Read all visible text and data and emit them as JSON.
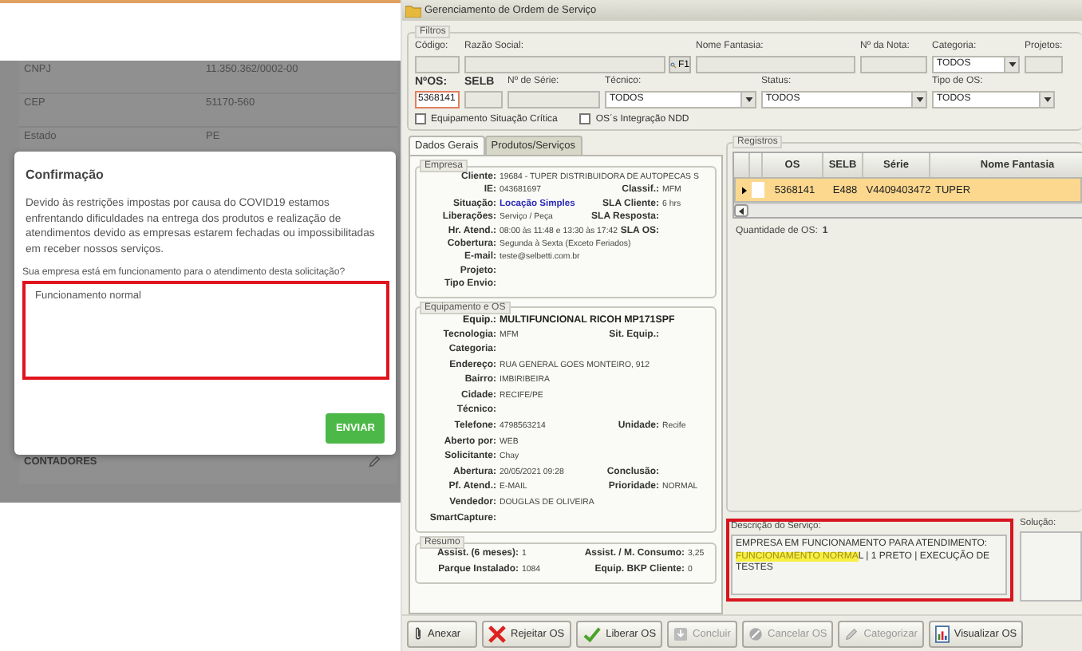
{
  "web_page": {
    "background_rows": [
      {
        "label": "CNPJ",
        "value": "11.350.362/0002-00"
      },
      {
        "label": "CEP",
        "value": "51170-560"
      },
      {
        "label": "Estado",
        "value": "PE"
      }
    ],
    "section": {
      "title": "CONTADORES"
    },
    "dialog": {
      "title": "Confirmação",
      "message": "Devido às restrições impostas por causa do COVID19 estamos enfrentando dificuldades na entrega dos produtos e realização de atendimentos devido as empresas estarem fechadas ou impossibilitadas em receber nossos serviços.",
      "question": "Sua empresa está em funcionamento para o atendimento desta solicitação?",
      "answer": {
        "value": "Funcionamento normal",
        "marked": true
      },
      "button": "ENVIAR"
    }
  },
  "window": {
    "title": "Gerenciamento de Ordem de Serviço",
    "filters": {
      "title": "Filtros",
      "row_1": [
        {
          "label": "Código:",
          "kind": "text",
          "bold": false
        },
        {
          "label": "Razão Social:",
          "kind": "lookup",
          "button": "F1",
          "bold": false
        },
        {
          "label": "Nome Fantasia:",
          "kind": "text",
          "bold": false
        },
        {
          "label": "Nº da Nota:",
          "kind": "text",
          "bold": false
        },
        {
          "label": "Categoria:",
          "kind": "select",
          "value": "TODOS",
          "bold": false
        },
        {
          "label": "Projetos:",
          "kind": "text",
          "bold": false
        }
      ],
      "row_2": [
        {
          "label": "NºOS:",
          "kind": "input",
          "value": "5368141",
          "bold": true
        },
        {
          "label": "SELB",
          "kind": "text",
          "bold": true
        },
        {
          "label": "Nº de Série:",
          "kind": "text",
          "bold": false
        },
        {
          "label": "Técnico:",
          "kind": "select",
          "value": "TODOS",
          "bold": false
        },
        {
          "label": "Status:",
          "kind": "select",
          "value": "TODOS",
          "bold": false
        },
        {
          "label": "Tipo de OS:",
          "kind": "select",
          "value": "TODOS",
          "bold": false
        }
      ],
      "checkboxes": [
        {
          "label": "Equipamento Situação Crítica",
          "checked": false
        },
        {
          "label": "OS´s Integração NDD",
          "checked": false
        }
      ]
    },
    "tabs": [
      {
        "label": "Dados Gerais",
        "selected": true
      },
      {
        "label": "Produtos/Serviços",
        "selected": false
      }
    ],
    "empresa": {
      "title": "Empresa",
      "rows": [
        {
          "label": "Cliente:",
          "value": "19684 - TUPER DISTRIBUIDORA DE AUTOPECAS S",
          "kind": "plain"
        },
        {
          "label": "IE:",
          "value": "043681697",
          "label2": "Classif.:",
          "value2": "MFM",
          "kind": "plain"
        },
        {
          "label": "Situação:",
          "value": "Locação Simples",
          "label2": "SLA Cliente:",
          "value2": "6 hrs",
          "kind": "status"
        },
        {
          "label": "Liberações:",
          "value": "Serviço / Peça",
          "label2": "SLA Resposta:",
          "kind": "plain"
        },
        {
          "label": "Hr. Atend.:",
          "value": "08:00 às 11:48 e 13:30 às 17:42",
          "label2": "SLA OS:",
          "kind": "plain"
        },
        {
          "label": "Cobertura:",
          "value": "Segunda à Sexta (Exceto Feriados)",
          "kind": "plain"
        },
        {
          "label": "E-mail:",
          "value": "teste@selbetti.com.br",
          "kind": "plain"
        },
        {
          "label": "Projeto:"
        },
        {
          "label": "Tipo Envio:"
        }
      ]
    },
    "equipamento": {
      "title": "Equipamento e OS",
      "equip_label": "Equip.:",
      "equip_value": "MULTIFUNCIONAL RICOH MP171SPF",
      "rows": [
        {
          "label": "Tecnologia:",
          "value": "MFM",
          "label2": "Sit. Equip.:"
        },
        {
          "label": "Categoria:"
        },
        {
          "label": "Endereço:",
          "value": "RUA GENERAL GOES MONTEIRO, 912"
        },
        {
          "label": "Bairro:",
          "value": "IMBIRIBEIRA"
        },
        {
          "label": "Cidade:",
          "value": "RECIFE/PE"
        },
        {
          "label": "Técnico:"
        },
        {
          "label": "Telefone:",
          "value": "4798563214",
          "label2": "Unidade:",
          "value2": "Recife"
        },
        {
          "label": "Aberto por:",
          "value": "WEB"
        },
        {
          "label": "Solicitante:",
          "value": "Chay"
        },
        {
          "label": "Abertura:",
          "value": "20/05/2021 09:28",
          "label2": "Conclusão:"
        },
        {
          "label": "Pf. Atend.:",
          "value": "E-MAIL",
          "label2": "Prioridade:",
          "value2": "NORMAL"
        },
        {
          "label": "Vendedor:",
          "value": "DOUGLAS DE OLIVEIRA"
        },
        {
          "label": "SmartCapture:"
        }
      ]
    },
    "resumo": {
      "title": "Resumo",
      "rows": [
        {
          "label": "Assist. (6 meses):",
          "value": "1",
          "label2": "Assist. / M. Consumo:",
          "value2": "3,25"
        },
        {
          "label": "Parque Instalado:",
          "value": "1084",
          "label2": "Equip. BKP Cliente:",
          "value2": "0"
        }
      ]
    },
    "registros": {
      "title": "Registros",
      "columns": [
        "OS",
        "SELB",
        "Série",
        "Nome Fantasia"
      ],
      "rows": [
        {
          "cells": [
            "5368141",
            "E488",
            "V4409403472",
            "TUPER"
          ],
          "selected": true
        }
      ],
      "count_label": "Quantidade de OS:",
      "count": "1"
    },
    "description": {
      "label": "Descrição do Serviço:",
      "text_before": "EMPRESA EM FUNCIONAMENTO PARA ATENDIMENTO: ",
      "highlight": "FUNCIONAMENTO NORMA",
      "text_after": "L | 1 PRETO | EXECUÇÃO DE TESTES",
      "marked": true
    },
    "solution": {
      "label": "Solução:"
    },
    "buttons": [
      {
        "label": "Anexar",
        "kind": "clip",
        "disabled": false
      },
      {
        "label": "Rejeitar OS",
        "kind": "x",
        "disabled": false
      },
      {
        "label": "Liberar OS",
        "kind": "check",
        "disabled": false
      },
      {
        "label": "Concluir",
        "kind": "tray",
        "disabled": true
      },
      {
        "label": "Cancelar OS",
        "kind": "cancel",
        "disabled": true
      },
      {
        "label": "Categorizar",
        "kind": "pencil",
        "disabled": true
      },
      {
        "label": "Visualizar OS",
        "kind": "report",
        "disabled": false
      }
    ]
  }
}
